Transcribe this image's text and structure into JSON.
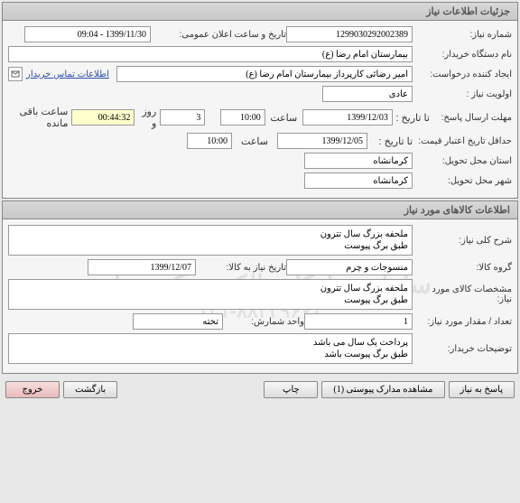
{
  "panel1": {
    "title": "جزئیات اطلاعات نیاز",
    "needNumberLabel": "شماره نیاز:",
    "needNumber": "1299030292002389",
    "publicDateLabel": "تاریخ و ساعت اعلان عمومی:",
    "publicDate": "1399/11/30 - 09:04",
    "orgLabel": "نام دستگاه خریدار:",
    "org": "بیمارستان امام رضا (ع)",
    "creatorLabel": "ایجاد کننده درخواست:",
    "creator": "امیر رضائی کارپرداز بیمارستان امام رضا (ع)",
    "contactLink": "اطلاعات تماس خریدار",
    "priorityLabel": "اولویت نیاز :",
    "priority": "عادی",
    "deadlineLabel": "مهلت ارسال پاسخ:",
    "untilLabel": "تا تاریخ :",
    "deadlineDate": "1399/12/03",
    "timeLabel": "ساعت",
    "deadlineTime": "10:00",
    "daysValue": "3",
    "daysLabel": "روز و",
    "countdown": "00:44:32",
    "remainLabel": "ساعت باقی مانده",
    "minValidLabel": "حداقل تاریخ اعتبار قیمت:",
    "minValidDate": "1399/12/05",
    "minValidTime": "10:00",
    "provinceLabel": "استان محل تحویل:",
    "province": "کرمانشاه",
    "cityLabel": "شهر محل تحویل:",
    "city": "کرمانشاه"
  },
  "panel2": {
    "title": "اطلاعات کالاهای مورد نیاز",
    "descLabel": "شرح کلی نیاز:",
    "desc": "ملحفه بزرگ سال تترون\nطبق برگ پیوست",
    "groupLabel": "گروه کالا:",
    "group": "منسوجات و چرم",
    "needByLabel": "تاریخ نیاز به کالا:",
    "needByDate": "1399/12/07",
    "specLabel": "مشخصات کالای مورد نیاز:",
    "spec": "ملحفه بزرگ سال تترون\nطبق برگ پیوست",
    "qtyLabel": "تعداد / مقدار مورد نیاز:",
    "qty": "1",
    "unitLabel": "واحد شمارش:",
    "unit": "تخته",
    "buyerNoteLabel": "توضیحات خریدار:",
    "buyerNote": "پرداخت یک سال می باشد\nطبق برگ پیوست باشد",
    "watermark": "سامانه تدارکات الکترونیکی دولت",
    "watermarkPhone": "۰۲۱-۸۸۳۴۹۶۷۰"
  },
  "buttons": {
    "reply": "پاسخ به نیاز",
    "attachments": "مشاهده مدارک پیوستی  (1)",
    "print": "چاپ",
    "back": "بازگشت",
    "exit": "خروج"
  }
}
